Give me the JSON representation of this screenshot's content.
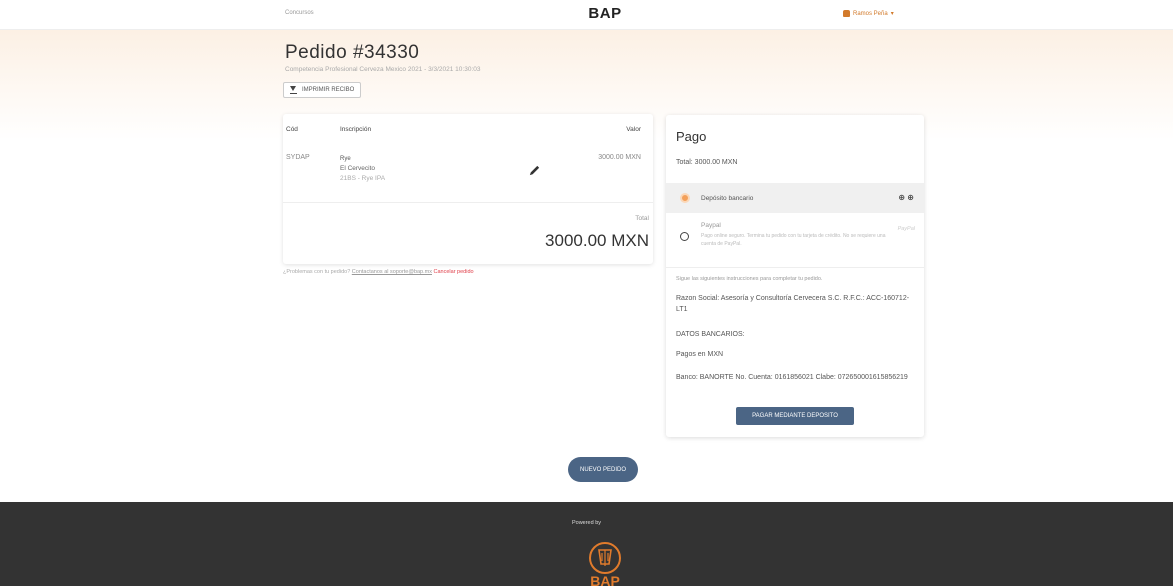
{
  "header": {
    "nav_link": "Concursos",
    "brand": "BAP",
    "user_name": "Ramos Peña"
  },
  "order": {
    "title": "Pedido #34330",
    "subtitle": "Competencia Profesional Cerveza Mexico 2021 - 3/3/2021 10:30:03",
    "receipt_button": "IMPRIMIR RECIBO"
  },
  "table": {
    "col_code": "Cód",
    "col_registration": "Inscripción",
    "col_value": "Valor",
    "rows": [
      {
        "code": "SYDAP",
        "name": "Rye",
        "brewery": "El Cervecito",
        "style": "21BS - Rye IPA",
        "value": "3000.00 MXN"
      }
    ],
    "total_label": "Total",
    "total_value": "3000.00 MXN"
  },
  "help": {
    "prefix": "¿Problemas con tu pedido?",
    "contact_link": "Contactanos al soporte@bap.mx",
    "cancel": "Cancelar pedido"
  },
  "payment": {
    "title": "Pago",
    "total": "Total: 3000.00 MXN",
    "option_bank": "Depósito bancario",
    "bank_icons": "⊕ ⊕",
    "option_paypal": "Paypal",
    "paypal_desc": "Pago online seguro. Termina tu pedido con tu tarjeta de crédito. No se requiere una cuenta de PayPal.",
    "paypal_brand": "PayPal",
    "instructions": "Sigue las siguientes instrucciones para completar tu pedido.",
    "razon_social": "Razon Social: Asesoría y Consultoría Cervecera S.C. R.F.C.: ACC-160712-LT1",
    "datos_bancarios": "DATOS BANCARIOS:",
    "pagos": "Pagos en MXN",
    "banco": "Banco: BANORTE No. Cuenta: 0161856021 Clabe: 072650001615856219",
    "pay_button": "PAGAR MEDIANTE DEPOSITO"
  },
  "new_order_button": "NUEVO PEDIDO",
  "footer": {
    "powered_by": "Powered by",
    "logo_text": "BAP"
  },
  "colors": {
    "accent": "#f3a05a",
    "brand_orange": "#d27a2b",
    "button_blue": "#4b6585",
    "footer_bg": "#333333",
    "cancel_red": "#e0404b"
  }
}
